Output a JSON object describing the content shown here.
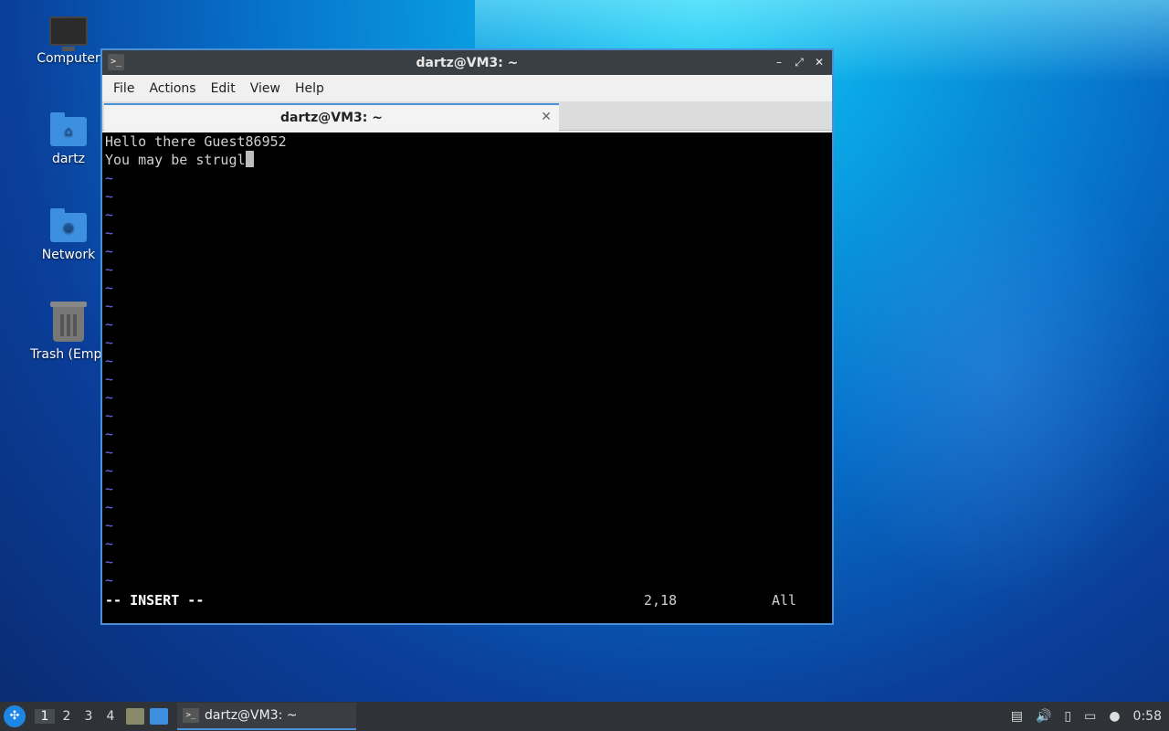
{
  "desktop": {
    "icons": [
      {
        "label": "Computer"
      },
      {
        "label": "dartz"
      },
      {
        "label": "Network"
      },
      {
        "label": "Trash (Empt"
      }
    ]
  },
  "window": {
    "title": "dartz@VM3: ~",
    "controls": {
      "minimize": "–",
      "maximize": "⤢",
      "close": "✕"
    },
    "menu": [
      "File",
      "Actions",
      "Edit",
      "View",
      "Help"
    ],
    "tab": {
      "label": "dartz@VM3: ~",
      "close": "✕"
    }
  },
  "terminal": {
    "lines": [
      "Hello there Guest86952",
      "You may be strugl"
    ],
    "tilde": "~",
    "mode": "-- INSERT --",
    "position": "2,18",
    "scroll": "All"
  },
  "taskbar": {
    "workspaces": [
      "1",
      "2",
      "3",
      "4"
    ],
    "task_label": "dartz@VM3: ~",
    "clock": "0:58"
  },
  "icons": {
    "computer": "computer-icon",
    "home_folder": "home-folder-icon",
    "network": "network-icon",
    "trash": "trash-icon",
    "start": "start-menu-icon",
    "volume": "volume-icon",
    "network_tray": "network-tray-icon"
  },
  "colors": {
    "accent": "#4a90d9",
    "titlebar": "#3a3f44",
    "terminal_bg": "#000000",
    "tilde": "#6a6af0"
  }
}
